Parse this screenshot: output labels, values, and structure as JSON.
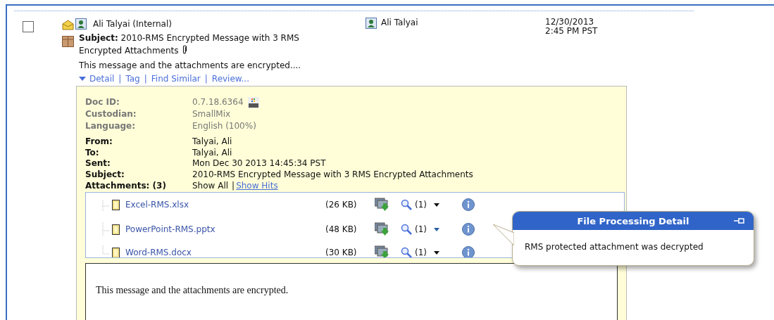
{
  "message": {
    "checked": false,
    "sender": "Ali Talyai (Internal)",
    "subject_label": "Subject:",
    "subject": "2010-RMS Encrypted Message with 3 RMS Encrypted Attachments",
    "snippet": "This message and the attachments are encrypted....",
    "recipient": "Ali Talyai",
    "date": "12/30/2013",
    "time": "2:45 PM PST",
    "actions": [
      "Detail",
      "Tag",
      "Find Similar",
      "Review..."
    ],
    "separator": "|",
    "expanded": true
  },
  "detail": {
    "meta": [
      {
        "label": "Doc ID:",
        "value": "0.7.18.6364",
        "rms": true
      },
      {
        "label": "Custodian:",
        "value": "SmallMix",
        "rms": false
      },
      {
        "label": "Language:",
        "value": "English (100%)",
        "rms": false
      }
    ],
    "fields": [
      {
        "label": "From:",
        "value": "Talyai, Ali"
      },
      {
        "label": "To:",
        "value": "Talyai, Ali"
      },
      {
        "label": "Sent:",
        "value": "Mon Dec 30 2013 14:45:34 PST"
      },
      {
        "label": "Subject:",
        "value": "2010-RMS Encrypted Message with 3 RMS Encrypted Attachments"
      }
    ],
    "attachments_label": "Attachments: (3)",
    "show_all": "Show All",
    "separator": "|",
    "show_hits": "Show Hits",
    "attachments": [
      {
        "name": "Excel-RMS.xlsx",
        "size": "(26 KB)",
        "hits": "(1)"
      },
      {
        "name": "PowerPoint-RMS.pptx",
        "size": "(48 KB)",
        "hits": "(1)"
      },
      {
        "name": "Word-RMS.docx",
        "size": "(30 KB)",
        "hits": "(1)"
      }
    ],
    "body": "This message and the attachments are encrypted."
  },
  "popup": {
    "title": "File Processing Detail",
    "text": "RMS protected attachment was decrypted"
  }
}
